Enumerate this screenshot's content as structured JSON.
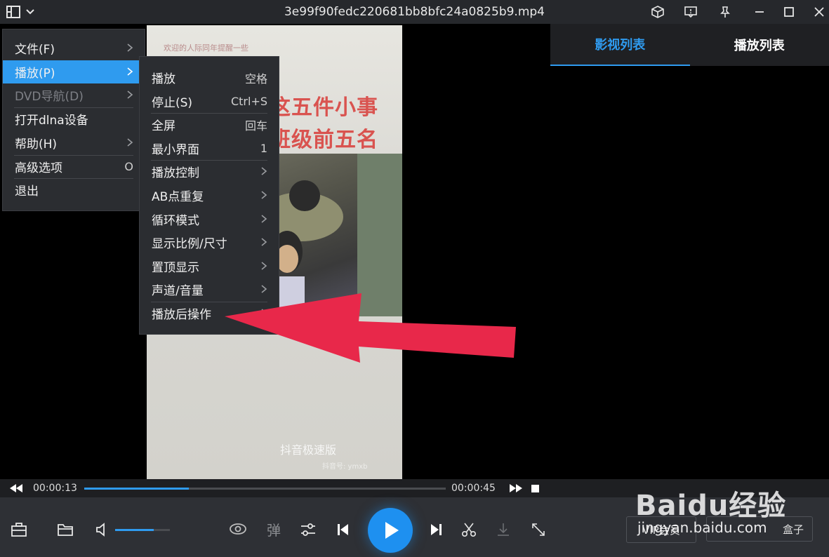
{
  "window": {
    "title": "3e99f90fedc220681bb8bfc24a0825b9.mp4"
  },
  "video": {
    "top_text": "欢迎的人际同年提醒一些",
    "headline_1": "这五件小事",
    "headline_2": "班级前五名",
    "watermark": "抖音极速版",
    "watermark_sub": "抖音号: ymxb"
  },
  "panel": {
    "tab_active": "影视列表",
    "tab_inactive": "播放列表"
  },
  "seek": {
    "current": "00:00:13",
    "total": "00:00:45",
    "progress": 0.29
  },
  "volume": {
    "level": 0.7
  },
  "controls": {
    "danmaku_label": "弹",
    "vip_label": "VIP会员",
    "box_label": "盒子"
  },
  "main_menu": [
    {
      "label": "文件(F)",
      "shortcut": "",
      "submenu": true
    },
    {
      "label": "播放(P)",
      "shortcut": "",
      "submenu": true
    },
    {
      "label": "DVD导航(D)",
      "shortcut": "",
      "submenu": true
    },
    {
      "label": "打开dlna设备",
      "shortcut": "",
      "submenu": false
    },
    {
      "label": "帮助(H)",
      "shortcut": "",
      "submenu": true
    },
    {
      "label": "高级选项",
      "shortcut": "O",
      "submenu": false
    },
    {
      "label": "退出",
      "shortcut": "",
      "submenu": false
    }
  ],
  "play_menu": [
    {
      "label": "播放",
      "shortcut": "空格",
      "submenu": false
    },
    {
      "label": "停止(S)",
      "shortcut": "Ctrl+S",
      "submenu": false
    },
    {
      "label": "全屏",
      "shortcut": "回车",
      "submenu": false
    },
    {
      "label": "最小界面",
      "shortcut": "1",
      "submenu": false
    },
    {
      "label": "播放控制",
      "shortcut": "",
      "submenu": true
    },
    {
      "label": "AB点重复",
      "shortcut": "",
      "submenu": true
    },
    {
      "label": "循环模式",
      "shortcut": "",
      "submenu": true
    },
    {
      "label": "显示比例/尺寸",
      "shortcut": "",
      "submenu": true
    },
    {
      "label": "置顶显示",
      "shortcut": "",
      "submenu": true
    },
    {
      "label": "声道/音量",
      "shortcut": "",
      "submenu": true
    },
    {
      "label": "播放后操作",
      "shortcut": "",
      "submenu": true
    }
  ],
  "baidu": {
    "logo": "Baidu经验",
    "url": "jingyan.baidu.com"
  },
  "colors": {
    "accent": "#2f9bef",
    "arrow": "#e8284a"
  }
}
